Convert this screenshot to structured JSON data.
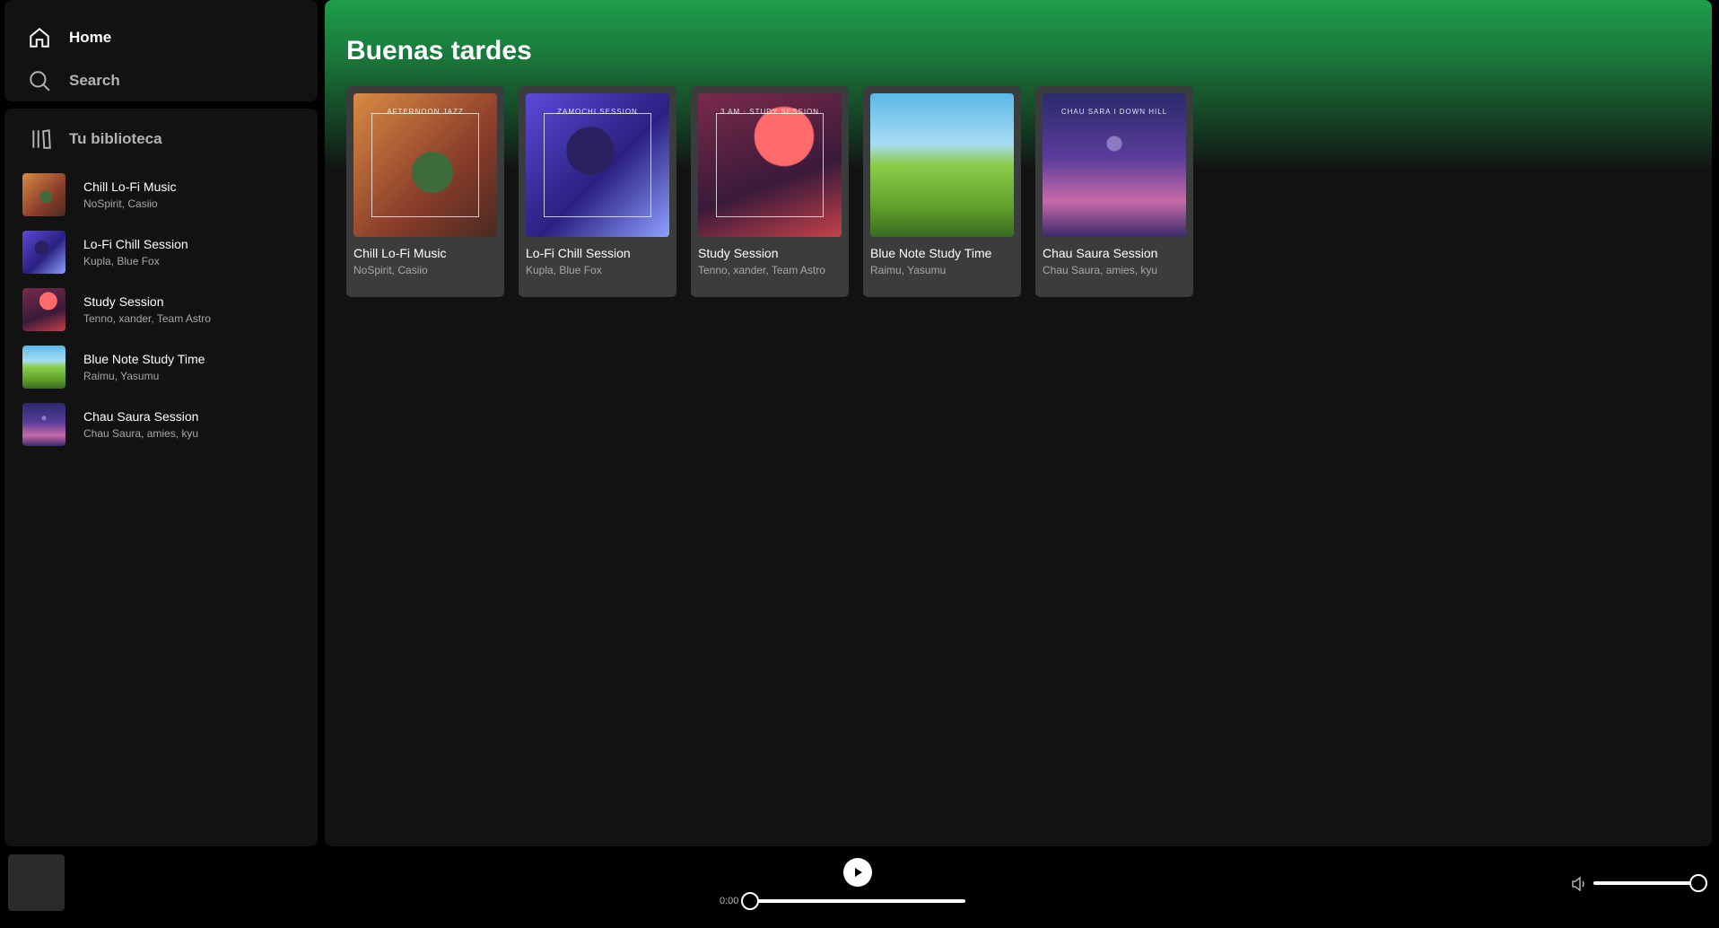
{
  "nav": {
    "home_label": "Home",
    "search_label": "Search"
  },
  "library": {
    "title": "Tu biblioteca",
    "items": [
      {
        "title": "Chill Lo-Fi Music",
        "subtitle": "NoSpirit, Casiio"
      },
      {
        "title": "Lo-Fi Chill Session",
        "subtitle": "Kupla, Blue Fox"
      },
      {
        "title": "Study Session",
        "subtitle": "Tenno, xander, Team Astro"
      },
      {
        "title": "Blue Note Study Time",
        "subtitle": "Raimu, Yasumu"
      },
      {
        "title": "Chau Saura Session",
        "subtitle": "Chau Saura, amies, kyu"
      }
    ]
  },
  "main": {
    "greeting": "Buenas tardes",
    "cards": [
      {
        "title": "Chill Lo-Fi Music",
        "subtitle": "NoSpirit, Casiio",
        "art_caption": "AFTERNOON JAZZ"
      },
      {
        "title": "Lo-Fi Chill Session",
        "subtitle": "Kupla, Blue Fox",
        "art_caption": "ZAMOCHI SESSION"
      },
      {
        "title": "Study Session",
        "subtitle": "Tenno, xander, Team Astro",
        "art_caption": "3 AM · STUDY SESSION"
      },
      {
        "title": "Blue Note Study Time",
        "subtitle": "Raimu, Yasumu",
        "art_caption": ""
      },
      {
        "title": "Chau Saura Session",
        "subtitle": "Chau Saura, amies, kyu",
        "art_caption": "CHAU SARA  I DOWN HILL"
      }
    ]
  },
  "player": {
    "time_elapsed": "0:00",
    "progress": 0.0,
    "volume": 1.0
  },
  "colors": {
    "accent_green": "#1e9e4a",
    "background": "#121212",
    "card": "#3a3c3e"
  }
}
